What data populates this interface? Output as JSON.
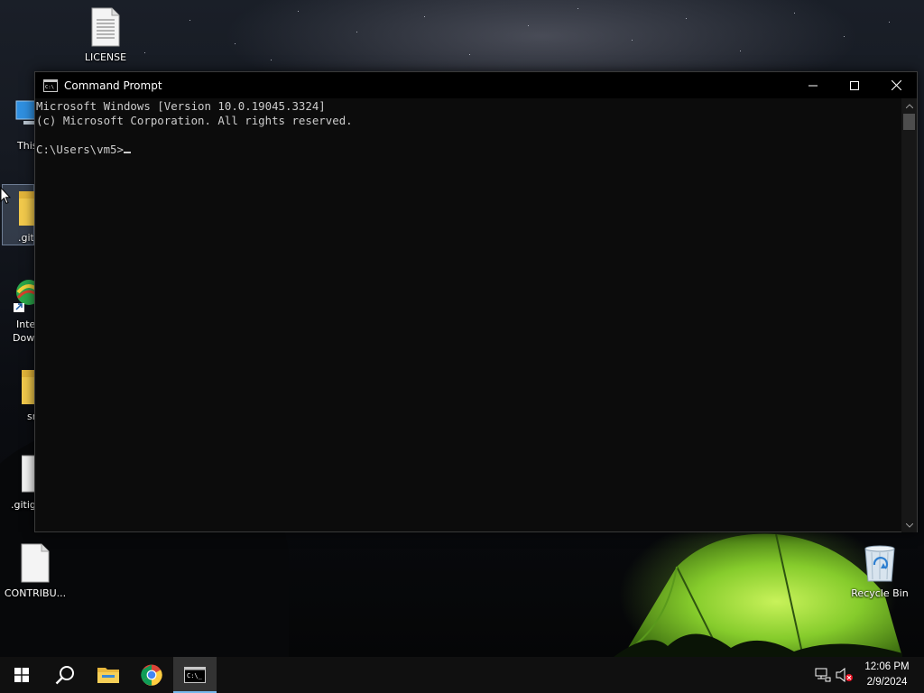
{
  "desktop": {
    "icons": [
      {
        "label": "LICENSE",
        "icon": "text-file-icon"
      },
      {
        "label": "This",
        "icon": "this-pc-icon"
      },
      {
        "label": ".giti",
        "icon": "folder-icon"
      },
      {
        "label": "Inte",
        "label2": "Dow",
        "icon": "internet-download-manager-icon"
      },
      {
        "label": "sr",
        "icon": "folder-icon"
      },
      {
        "label": ".gitig",
        "icon": "blank-file-icon"
      },
      {
        "label": "CONTRIBU...",
        "icon": "blank-file-icon"
      },
      {
        "label": "Recycle Bin",
        "icon": "recycle-bin-icon"
      }
    ]
  },
  "window": {
    "title": "Command Prompt",
    "lines": [
      "Microsoft Windows [Version 10.0.19045.3324]",
      "(c) Microsoft Corporation. All rights reserved.",
      "",
      "C:\\Users\\vm5>"
    ]
  },
  "taskbar": {
    "items": [
      "start-icon",
      "search-icon",
      "file-explorer-icon",
      "chrome-icon",
      "command-prompt-icon"
    ],
    "active": "command-prompt-icon",
    "clock": {
      "time": "12:06 PM",
      "date": "2/9/2024"
    }
  },
  "colors": {
    "console_bg": "#0c0c0c",
    "console_text": "#cccccc",
    "taskbar_bg": "#101010",
    "accent": "#76b9ed"
  }
}
